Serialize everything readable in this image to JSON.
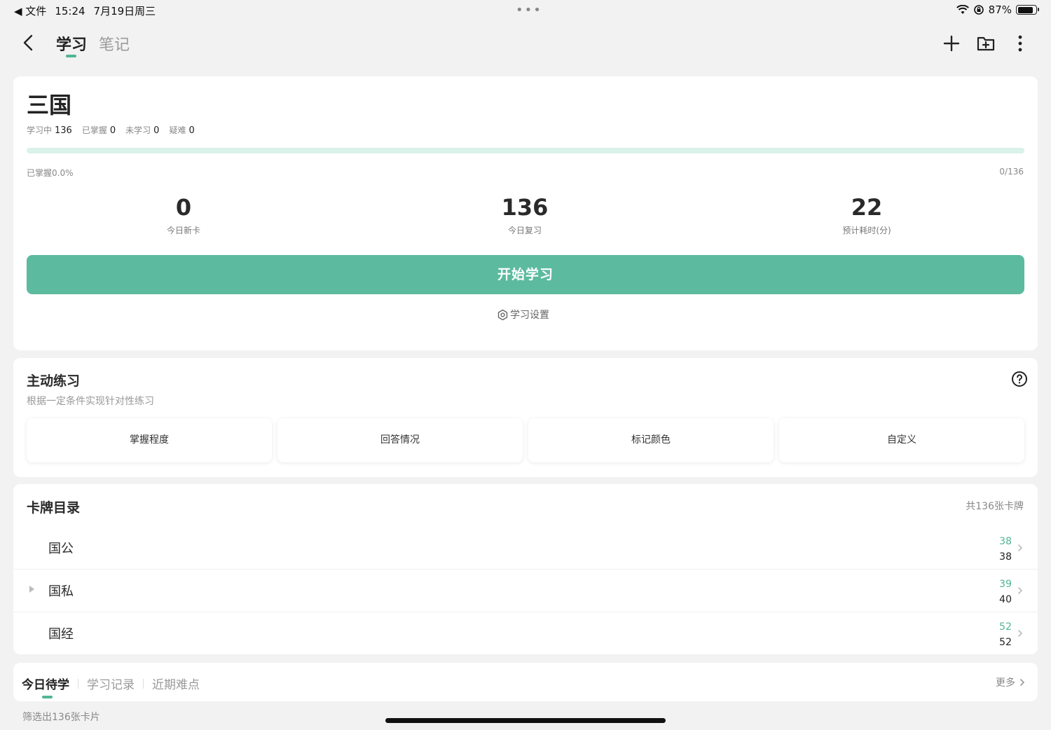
{
  "status_bar": {
    "back_app": "◀ 文件",
    "time": "15:24",
    "date": "7月19日周三",
    "battery_percent": "87%",
    "battery_level": 0.87
  },
  "nav": {
    "tab_study": "学习",
    "tab_notes": "笔记"
  },
  "deck": {
    "title": "三国",
    "stats": [
      {
        "label": "学习中",
        "value": "136"
      },
      {
        "label": "已掌握",
        "value": "0"
      },
      {
        "label": "未学习",
        "value": "0"
      },
      {
        "label": "疑难",
        "value": "0"
      }
    ],
    "mastered_label": "已掌握0.0%",
    "mastered_count": "0/136",
    "progress_fraction": 0.0,
    "metrics": [
      {
        "value": "0",
        "label": "今日新卡"
      },
      {
        "value": "136",
        "label": "今日复习"
      },
      {
        "value": "22",
        "label": "预计耗时(分)"
      }
    ],
    "start_button": "开始学习",
    "settings_link": "学习设置"
  },
  "practice": {
    "title": "主动练习",
    "subtitle": "根据一定条件实现针对性练习",
    "buttons": [
      "掌握程度",
      "回答情况",
      "标记颜色",
      "自定义"
    ]
  },
  "catalog": {
    "title": "卡牌目录",
    "total": "共136张卡牌",
    "decks": [
      {
        "name": "国公",
        "due": "38",
        "total": "38",
        "expandable": false
      },
      {
        "name": "国私",
        "due": "39",
        "total": "40",
        "expandable": true
      },
      {
        "name": "国经",
        "due": "52",
        "total": "52",
        "expandable": false
      }
    ]
  },
  "today": {
    "tabs": [
      "今日待学",
      "学习记录",
      "近期难点"
    ],
    "more": "更多",
    "filter_text": "筛选出136张卡片"
  },
  "colors": {
    "accent": "#5cba9f",
    "accent_light": "#d9f2ea",
    "background": "#f2f2f3"
  }
}
